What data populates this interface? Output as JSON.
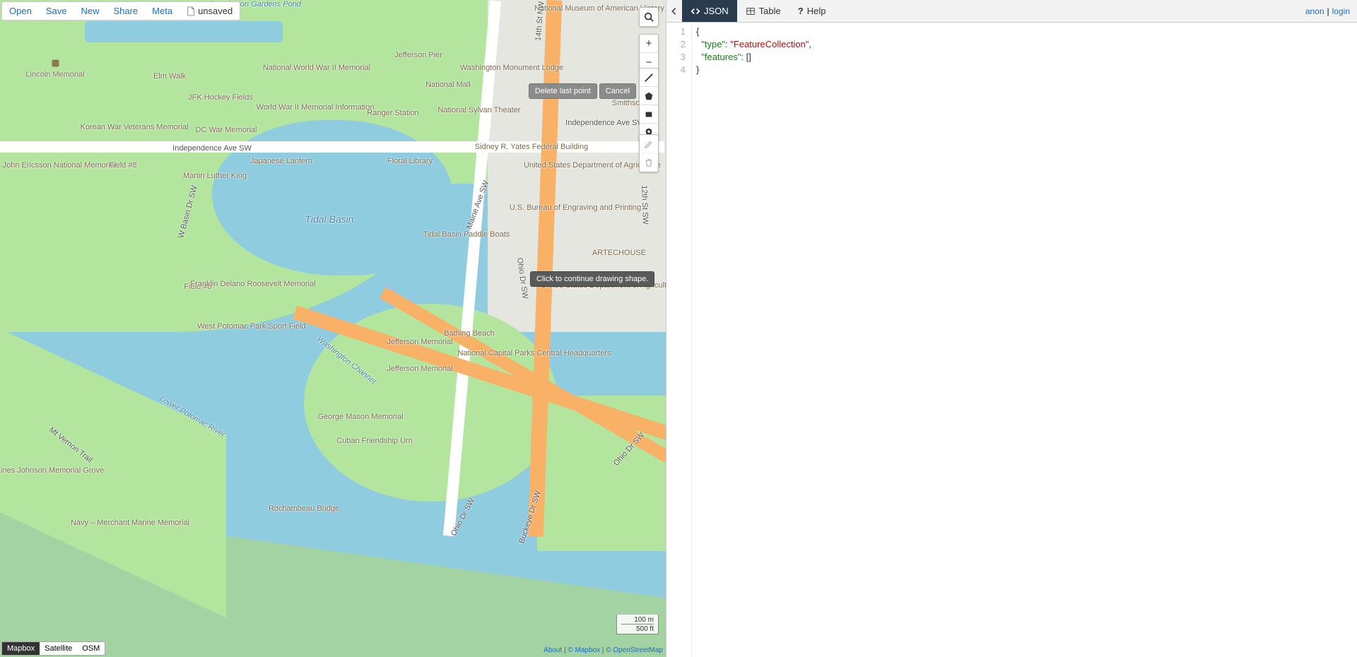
{
  "menu": {
    "open": "Open",
    "save": "Save",
    "new_": "New",
    "share": "Share",
    "meta": "Meta",
    "filename": "unsaved"
  },
  "map": {
    "baselayers": {
      "mapbox": "Mapbox",
      "satellite": "Satellite",
      "osm": "OSM",
      "active": "mapbox"
    },
    "scale": {
      "metric": "100 m",
      "imperial": "500 ft"
    },
    "attribution": {
      "about": "About",
      "mapbox": "© Mapbox",
      "osm": "© OpenStreetMap"
    },
    "tooltip": "Click to continue drawing shape.",
    "draw_actions": {
      "delete_last": "Delete last point",
      "cancel": "Cancel"
    },
    "labels": {
      "lincoln": "Lincoln Memorial",
      "elmwalk": "Elm Walk",
      "jfk": "JFK Hockey Fields",
      "korean": "Korean War\nVeterans Memorial",
      "dcwar": "DC War Memorial",
      "ww2": "National World\nWar II Memorial",
      "ww2info": "World War II Memorial\nInformation",
      "jpier": "Jefferson Pier",
      "ranger": "Ranger Station",
      "constitution": "Constitution\nGardens Pond",
      "monlodge": "Washington\nMonument Lodge",
      "natmall": "National Mall",
      "sylvan": "National Sylvan\nTheater",
      "nmah": "National Museum of\nAmerican History",
      "smithsonian": "Smithsonian",
      "indep": "Independence Ave SW",
      "indep2": "Independence Ave SW",
      "ericsson": "John Ericsson\nNational Memorial",
      "field8": "Field #8",
      "mlk": "Martin Luther King",
      "lantern": "Japanese Lantern",
      "floral": "Floral Library",
      "yates": "Sidney R. Yates\nFederal Building",
      "usda": "United States Department\nof Agriculture",
      "usda2": "United States\nDepartment\nof Agriculture",
      "bep": "U.S. Bureau of Engraving\nand Printing",
      "arte": "ARTECHOUSE",
      "tidal": "Tidal Basin",
      "paddle": "Tidal Basin\nPaddle Boats",
      "field6": "Field #6",
      "fdr": "Franklin Delano\nRoosevelt Memorial",
      "wpotomac": "West Potomac\nPark Sport Field",
      "bathing": "Bathing Beach",
      "jeffmem": "Jefferson Memorial",
      "jeffmem2": "Jefferson Memorial",
      "ncp": "National Capital Parks\nCentral Headquarters",
      "gmason": "George Mason\nMemorial",
      "cuban": "Cuban Friendship Urn",
      "roch": "Rochambeau Bridge",
      "navy": "Navy – Merchant\nMarine Memorial",
      "lbj": "Lyndon Baines Johnson\nMemorial Grove",
      "vernon": "Mt Vernon Trail",
      "lpot": "Lower Potomac River",
      "wchan": "Washington Channel",
      "wbasin": "W Basin Dr SW",
      "maine": "Maine Ave SW",
      "ohio1": "Ohio Dr SW",
      "ohio2": "Ohio Dr SW",
      "ohio3": "Ohio Dr SW",
      "buckeye": "Buckeye Dr SW",
      "twelfth": "12th St SW",
      "fourteenth": "14th St NW"
    }
  },
  "tabs": {
    "json": "JSON",
    "table": "Table",
    "help": "Help",
    "active": "json"
  },
  "auth": {
    "anon": "anon",
    "sep": "|",
    "login": "login"
  },
  "editor": {
    "lines": [
      "1",
      "2",
      "3",
      "4"
    ],
    "geojson": {
      "type": "FeatureCollection",
      "features": []
    },
    "tok": {
      "l1": "{",
      "l2_key": "\"type\"",
      "l2_colon": ": ",
      "l2_val": "\"FeatureCollection\"",
      "l2_comma": ",",
      "l3_key": "\"features\"",
      "l3_colon": ": ",
      "l3_val": "[]",
      "l4": "}"
    }
  }
}
